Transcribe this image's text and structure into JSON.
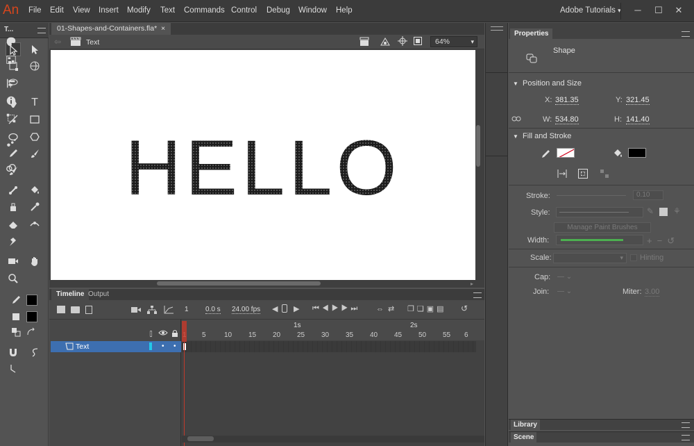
{
  "app": {
    "logo": "An",
    "workspace": "Adobe Tutorials"
  },
  "menu": [
    "File",
    "Edit",
    "View",
    "Insert",
    "Modify",
    "Text",
    "Commands",
    "Control",
    "Debug",
    "Window",
    "Help"
  ],
  "window_controls": [
    "─",
    "☐",
    "✕"
  ],
  "tools_panel": {
    "title": "T..."
  },
  "document": {
    "tab_label": "01-Shapes-and-Containers.fla*",
    "tab_close": "×",
    "scene_label": "Text",
    "zoom": "64%"
  },
  "stage": {
    "text": "HELLO"
  },
  "timeline": {
    "tabs": [
      "Timeline",
      "Output"
    ],
    "current_frame": "1",
    "elapsed": "0.0 s",
    "fps": "24.00 fps",
    "ruler_seconds": [
      "1s",
      "2s"
    ],
    "ruler_frames": [
      "1",
      "5",
      "10",
      "15",
      "20",
      "25",
      "30",
      "35",
      "40",
      "45",
      "50",
      "55",
      "6"
    ],
    "layers": [
      {
        "name": "Text",
        "color": "#23c8e8"
      }
    ]
  },
  "properties": {
    "tab": "Properties",
    "object_type": "Shape",
    "position_and_size": {
      "title": "Position and Size",
      "x_label": "X:",
      "x": "381.35",
      "y_label": "Y:",
      "y": "321.45",
      "w_label": "W:",
      "w": "534.80",
      "h_label": "H:",
      "h": "141.40"
    },
    "fill_and_stroke": {
      "title": "Fill and Stroke",
      "stroke_label": "Stroke:",
      "stroke_value": "0.10",
      "style_label": "Style:",
      "manage_brushes": "Manage Paint Brushes",
      "width_label": "Width:",
      "scale_label": "Scale:",
      "hinting_label": "Hinting",
      "cap_label": "Cap:",
      "join_label": "Join:",
      "miter_label": "Miter:",
      "miter_value": "3.00",
      "fill_color": "#000000"
    },
    "bottom_tabs": [
      "Library",
      "Scene"
    ]
  }
}
